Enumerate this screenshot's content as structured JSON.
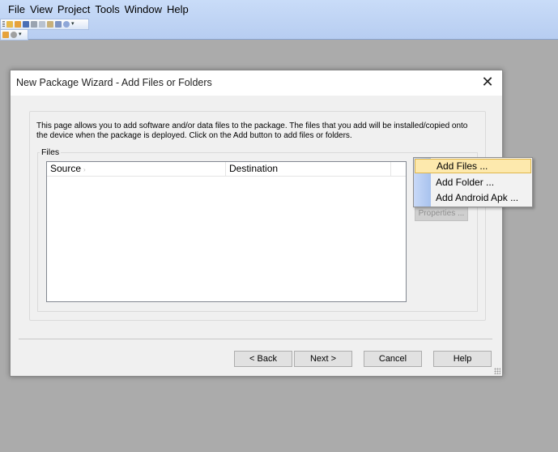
{
  "menubar": {
    "items": [
      "File",
      "View",
      "Project",
      "Tools",
      "Window",
      "Help"
    ]
  },
  "toolbar": {
    "row1_icons": [
      "new-icon",
      "open-icon",
      "save-icon",
      "cut-icon",
      "copy-icon",
      "paste-icon",
      "undo-icon",
      "find-icon"
    ],
    "row2_icons": [
      "package-icon",
      "settings-icon"
    ]
  },
  "dialog": {
    "title": "New Package Wizard - Add Files or Folders",
    "close_glyph": "✕",
    "description": "This page allows you to add software and/or data files to the package. The files that you add will be installed/copied onto the device when the package is deployed. Click on the Add button to add files or folders.",
    "files_label": "Files",
    "columns": {
      "source": "Source",
      "destination": "Destination"
    },
    "properties_button": "Properties ...",
    "buttons": {
      "back": "< Back",
      "next": "Next >",
      "cancel": "Cancel",
      "help": "Help"
    }
  },
  "popup_menu": {
    "items": [
      "Add Files ...",
      "Add Folder ...",
      "Add Android Apk ..."
    ],
    "highlighted_index": 0
  },
  "colors": {
    "menubar": "#c9dcf8",
    "highlight": "#fde9ad",
    "background": "#ababab"
  }
}
